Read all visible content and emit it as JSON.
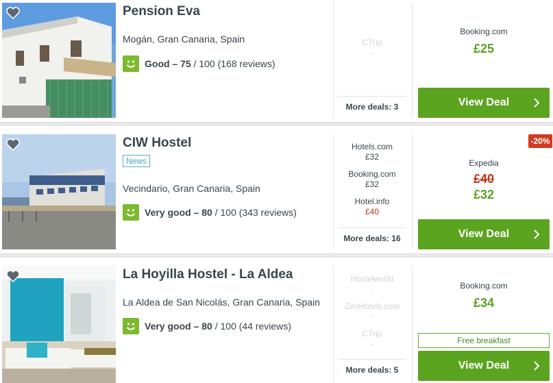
{
  "hotels": [
    {
      "name": "Pension Eva",
      "tag": "",
      "location": "Mogán, Gran Canaria, Spain",
      "rating_label": "Good – 75",
      "rating_suffix": " / 100 (168 reviews)",
      "deals": [
        {
          "site": "CTrip",
          "price": "-"
        }
      ],
      "more_deals": "More deals: 3",
      "best_site": "Booking.com",
      "old_price": "",
      "price": "£25",
      "button": "View Deal",
      "badge": "",
      "perk": ""
    },
    {
      "name": "CIW Hostel",
      "tag": "News",
      "location": "Vecindario, Gran Canaria, Spain",
      "rating_label": "Very good – 80",
      "rating_suffix": " / 100 (343 reviews)",
      "deals": [
        {
          "site": "Hotels.com",
          "price": "£32"
        },
        {
          "site": "Booking.com",
          "price": "£32"
        },
        {
          "site": "Hotel.info",
          "price": "£40"
        }
      ],
      "more_deals": "More deals: 16",
      "best_site": "Expedia",
      "old_price": "£40",
      "price": "£32",
      "button": "View Deal",
      "badge": "-20%",
      "perk": ""
    },
    {
      "name": "La Hoyilla Hostel - La Aldea",
      "tag": "",
      "location": "La Aldea de San Nicolás, Gran Canaria, Spain",
      "rating_label": "Very good – 80",
      "rating_suffix": " / 100 (44 reviews)",
      "deals": [
        {
          "site": "Hostelworld",
          "price": "-"
        },
        {
          "site": "ZenHotels.com",
          "price": "-"
        },
        {
          "site": "CTrip",
          "price": "-"
        }
      ],
      "more_deals": "More deals: 5",
      "best_site": "Booking.com",
      "old_price": "",
      "price": "£34",
      "button": "View Deal",
      "badge": "",
      "perk": "Free breakfast"
    }
  ],
  "colors": {
    "accent_green": "#5ba420",
    "price_green": "#5ba226",
    "rating_green": "#7dba2f",
    "discount_red": "#d33b1f",
    "old_price_red": "#b8381b"
  },
  "icons": [
    "heart-icon",
    "smiley-icon",
    "chevron-right-icon"
  ]
}
